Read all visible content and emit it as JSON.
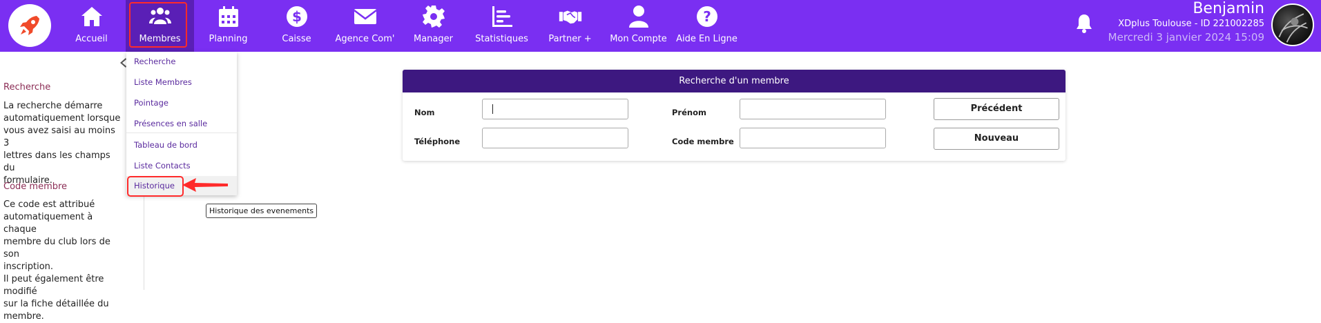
{
  "colors": {
    "topbar": "#7a2ff2",
    "card_header": "#3d1880",
    "accent_text": "#8b2d55",
    "highlight": "#ff2a2a"
  },
  "nav": [
    {
      "label": "Accueil",
      "icon": "home-icon"
    },
    {
      "label": "Membres",
      "icon": "users-icon"
    },
    {
      "label": "Planning",
      "icon": "calendar-icon"
    },
    {
      "label": "Caisse",
      "icon": "dollar-icon"
    },
    {
      "label": "Agence Com'",
      "icon": "envelope-icon"
    },
    {
      "label": "Manager",
      "icon": "gear-icon"
    },
    {
      "label": "Statistiques",
      "icon": "chart-icon"
    },
    {
      "label": "Partner +",
      "icon": "handshake-icon"
    },
    {
      "label": "Mon Compte",
      "icon": "user-icon"
    },
    {
      "label": "Aide En Ligne",
      "icon": "question-icon"
    }
  ],
  "user": {
    "name": "Benjamin",
    "club": "XDplus Toulouse - ID 221002285",
    "date": "Mercredi 3 janvier 2024 15:09"
  },
  "dropdown": {
    "items": [
      "Recherche",
      "Liste Membres",
      "Pointage",
      "Présences en salle",
      "Tableau de bord",
      "Liste Contacts",
      "Historique"
    ]
  },
  "tooltip": "Historique des evenements",
  "help": {
    "section1_title": "Recherche",
    "section1_lines": [
      "La recherche démarre",
      "automatiquement lorsque",
      "vous avez saisi au moins 3",
      "lettres dans les champs du",
      "formulaire."
    ],
    "section2_title": "Code membre",
    "section2_lines": [
      "Ce code est attribué",
      "automatiquement à chaque",
      "membre du club lors de son",
      "inscription.",
      "Il peut également être modifié",
      "sur la fiche détaillée du",
      "membre."
    ]
  },
  "search": {
    "title": "Recherche d'un membre",
    "nom_label": "Nom",
    "prenom_label": "Prénom",
    "telephone_label": "Téléphone",
    "code_label": "Code membre",
    "nom_value": "",
    "prenom_value": "",
    "telephone_value": "",
    "code_value": "",
    "btn_precedent": "Précédent",
    "btn_nouveau": "Nouveau"
  }
}
